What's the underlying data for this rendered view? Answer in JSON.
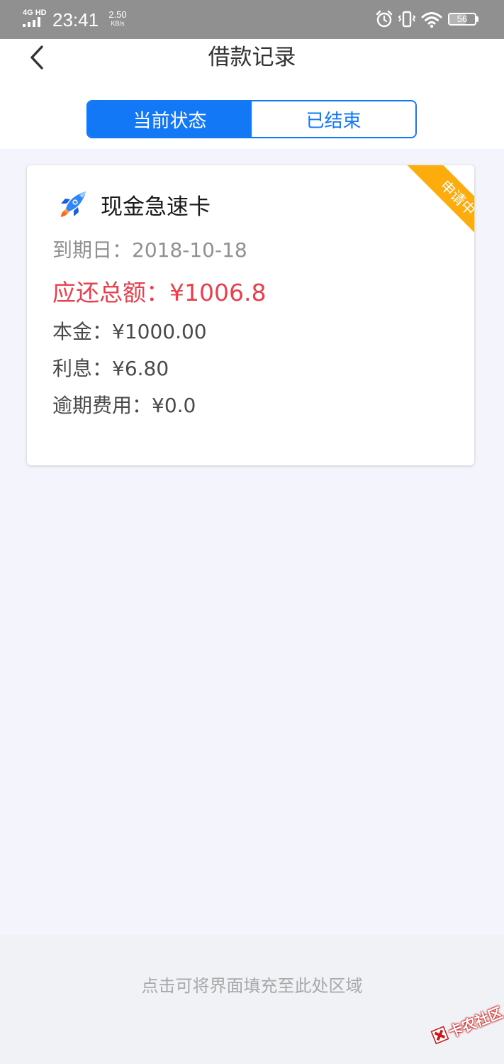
{
  "status_bar": {
    "network": "4G HD",
    "time": "23:41",
    "speed_value": "2.50",
    "speed_unit": "KB/s",
    "battery": "56",
    "icons": [
      "signal-icon",
      "alarm-icon",
      "vibrate-icon",
      "wifi-icon",
      "battery-icon"
    ]
  },
  "header": {
    "title": "借款记录",
    "back_icon": "chevron-left-icon"
  },
  "tabs": [
    {
      "label": "当前状态",
      "active": true
    },
    {
      "label": "已结束",
      "active": false
    }
  ],
  "loan": {
    "product_name": "现金急速卡",
    "product_icon": "rocket-icon",
    "status": "申请中",
    "due_date": "到期日：2018-10-18",
    "total_due": "应还总额：¥1006.8",
    "principal": "本金：¥1000.00",
    "interest": "利息：¥6.80",
    "overdue_fee": "逾期费用：¥0.0"
  },
  "fill_hint": "点击可将界面填充至此处区域",
  "watermark": "卡农社区",
  "colors": {
    "accent": "#1378f5",
    "status_ribbon": "#fcac0c",
    "amount_due": "#e5414f",
    "status_bar": "#909090",
    "page_background": "#f4f5fc"
  }
}
